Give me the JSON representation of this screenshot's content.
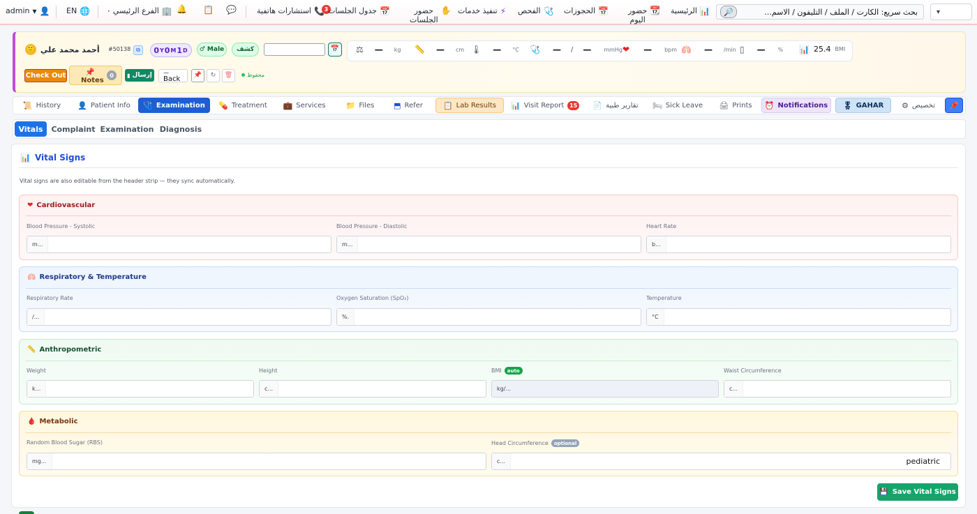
{
  "topbar": {
    "user": "admin",
    "lang": "EN",
    "branch": "الفرع الرئيسي",
    "phone_consult": "استشارات هاتفية",
    "phone_badge": "3",
    "sessions_table": "جدول الجلسات",
    "sessions_attend_1": "حضور",
    "sessions_attend_2": "الجلسات",
    "services_exec": "تنفيذ خدمات",
    "exam": "الفحص",
    "bookings": "الحجوزات",
    "today_attend_1": "حضور",
    "today_attend_2": "اليوم",
    "home": "الرئيسية",
    "search_text": "بحث سريع: الكارت / الملف / التليفون / الاسم...",
    "logo_text": "▾"
  },
  "patient": {
    "name": "أحمد محمد علي",
    "id": "#50138",
    "age_y": "0",
    "age_y_u": "Y",
    "age_m": "0",
    "age_m_u": "M",
    "age_d": "1",
    "age_d_u": "D",
    "gender": "Male",
    "visit_type": "كشف",
    "checkout": "Check Out",
    "notes": "Notes",
    "notes_count": "0",
    "send": "إرسال",
    "back_dash": "—",
    "back": "Back",
    "saved": "محفوظ"
  },
  "header_vitals": {
    "weight": {
      "value": "—",
      "unit": "kg"
    },
    "height": {
      "value": "—",
      "unit": "cm"
    },
    "temp": {
      "value": "—",
      "unit": "°C"
    },
    "bp": {
      "sys": "—",
      "slash": "/",
      "dia": "—",
      "unit": "mmHg"
    },
    "hr": {
      "value": "—",
      "unit": "bpm"
    },
    "rr": {
      "value": "—",
      "unit": "/min"
    },
    "spo2": {
      "value": "—",
      "unit": "%"
    },
    "bmi": {
      "value": "25.4",
      "unit": "BMI"
    }
  },
  "tabs": [
    "History",
    "Patient Info",
    "Examination",
    "Treatment",
    "Services",
    "Files",
    "Refer",
    "Lab Results",
    "Visit Report",
    "تقارير طبية",
    "Sick Leave",
    "Prints",
    "Notifications",
    "GAHAR",
    "تخصيص"
  ],
  "visit_report_badge": "15",
  "subtabs": [
    "Vitals",
    "Complaint",
    "Examination",
    "Diagnosis"
  ],
  "vitals": {
    "title": "Vital Signs",
    "hint": "Vital signs are also editable from the header strip — they sync automatically.",
    "cardio": {
      "title": "Cardiovascular",
      "fields": [
        {
          "label": "Blood Pressure - Systolic",
          "unit": "m..."
        },
        {
          "label": "Blood Pressure - Diastolic",
          "unit": "m..."
        },
        {
          "label": "Heart Rate",
          "unit": "b..."
        }
      ]
    },
    "resp": {
      "title": "Respiratory & Temperature",
      "fields": [
        {
          "label": "Respiratory Rate",
          "unit": "/..."
        },
        {
          "label": "Oxygen Saturation (SpO₂)",
          "unit": "%."
        },
        {
          "label": "Temperature",
          "unit": "°C"
        }
      ]
    },
    "anthro": {
      "title": "Anthropometric",
      "fields": [
        {
          "label": "Weight",
          "unit": "k..."
        },
        {
          "label": "Height",
          "unit": "c..."
        },
        {
          "label": "BMI",
          "unit": "kg/...",
          "tag": "auto"
        },
        {
          "label": "Waist Circumference",
          "unit": "c..."
        }
      ]
    },
    "metabolic": {
      "title": "Metabolic",
      "fields": [
        {
          "label": "Random Blood Sugar (RBS)",
          "unit": "mg..."
        },
        {
          "label": "Head Circumference",
          "unit": "c...",
          "tag": "optional",
          "value": "pediatric"
        }
      ]
    },
    "save": "Save Vital Signs"
  },
  "colors": {
    "primary": "#1d5fd1",
    "accent_orange": "#ea8a0c",
    "success": "#16a46a",
    "danger": "#e53935"
  }
}
